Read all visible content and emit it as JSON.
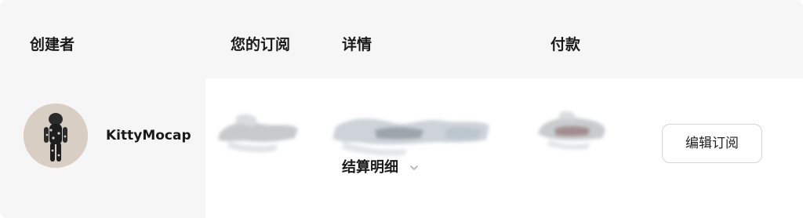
{
  "columns": {
    "creator": "创建者",
    "subscription": "您的订阅",
    "details": "详情",
    "payment": "付款"
  },
  "row": {
    "creator_name": "KittyMocap",
    "details_toggle_label": "结算明细",
    "edit_button_label": "编辑订阅"
  },
  "icons": {
    "details_toggle": "chevron-down-icon",
    "avatar": "avatar"
  },
  "colors": {
    "page_background": "#f6f6f7",
    "row_background": "#ffffff",
    "button_border": "#d5d5d9"
  }
}
